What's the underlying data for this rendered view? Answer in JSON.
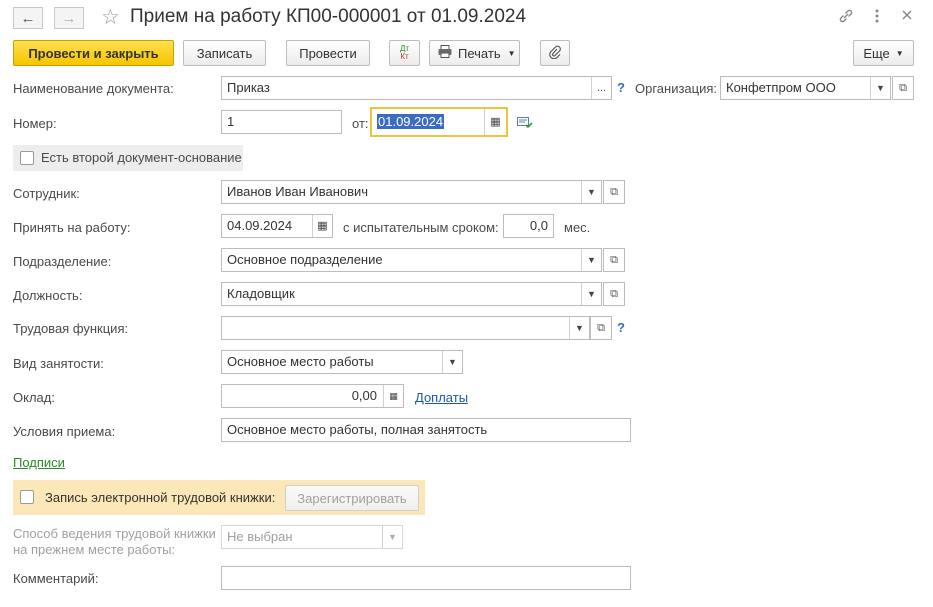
{
  "window": {
    "title": "Прием на работу КП00-000001 от 01.09.2024",
    "back_icon": "arrow-left-icon",
    "forward_icon": "arrow-right-icon",
    "star_icon": "star-outline-icon",
    "link_icon": "link-icon",
    "menu_icon": "more-vertical-icon",
    "close_icon": "close-icon"
  },
  "toolbar": {
    "post_close": "Провести и закрыть",
    "save": "Записать",
    "post": "Провести",
    "dtkt_top": "Дт",
    "dtkt_bottom": "Кт",
    "print": "Печать",
    "attach_icon": "paperclip-icon",
    "more": "Еще"
  },
  "form": {
    "doc_name_label": "Наименование документа:",
    "doc_name_value": "Приказ",
    "org_label": "Организация:",
    "org_value": "Конфетпром ООО",
    "number_label": "Номер:",
    "number_value": "1",
    "date_from_label": "от:",
    "date_value": "01.09.2024",
    "second_doc_label": "Есть второй документ-основание",
    "employee_label": "Сотрудник:",
    "employee_value": "Иванов Иван Иванович",
    "hire_label": "Принять на работу:",
    "hire_date": "04.09.2024",
    "probation_label": "с испытательным сроком:",
    "probation_value": "0,0",
    "probation_unit": "мес.",
    "dept_label": "Подразделение:",
    "dept_value": "Основное подразделение",
    "position_label": "Должность:",
    "position_value": "Кладовщик",
    "labor_func_label": "Трудовая функция:",
    "labor_func_value": "",
    "employment_label": "Вид занятости:",
    "employment_value": "Основное место работы",
    "salary_label": "Оклад:",
    "salary_value": "0,00",
    "surcharges_link": "Доплаты",
    "conditions_label": "Условия приема:",
    "conditions_value": "Основное место работы, полная занятость",
    "signatures_link": "Подписи",
    "e_book_label": "Запись электронной трудовой книжки:",
    "register_button": "Зарегистрировать",
    "book_method_label_1": "Способ ведения трудовой книжки",
    "book_method_label_2": "на прежнем месте работы:",
    "book_method_value": "Не выбран",
    "comment_label": "Комментарий:",
    "comment_value": "",
    "help_mark": "?"
  },
  "colors": {
    "primary_button": "#f6c500",
    "focus_border": "#f0c242",
    "highlight_panel": "#fbe7b8",
    "link": "#1a5aa8",
    "link_green": "#2a8a2a"
  }
}
